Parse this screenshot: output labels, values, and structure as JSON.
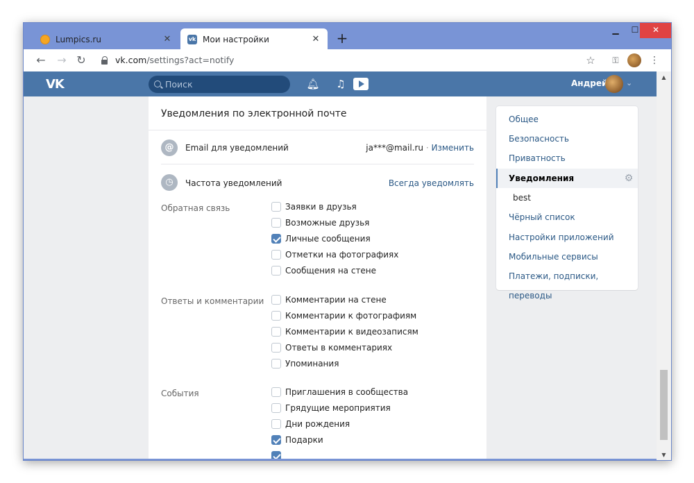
{
  "browser": {
    "tabs": [
      {
        "title": "Lumpics.ru",
        "favicon": "lumpics-icon"
      },
      {
        "title": "Мои настройки",
        "favicon": "vk-icon"
      }
    ],
    "url": {
      "host": "vk.com",
      "path": "/settings?act=notify"
    }
  },
  "vk": {
    "logo": "VK",
    "search_placeholder": "Поиск",
    "user_name": "Андрей"
  },
  "email_section": {
    "title": "Уведомления по электронной почте",
    "email_label": "Email для уведомлений",
    "email_value": "ja***@mail.ru",
    "change_link": "Изменить",
    "frequency_label": "Частота уведомлений",
    "frequency_value": "Всегда уведомлять"
  },
  "groups": [
    {
      "label": "Обратная связь",
      "options": [
        {
          "label": "Заявки в друзья",
          "checked": false
        },
        {
          "label": "Возможные друзья",
          "checked": false
        },
        {
          "label": "Личные сообщения",
          "checked": true
        },
        {
          "label": "Отметки на фотографиях",
          "checked": false
        },
        {
          "label": "Сообщения на стене",
          "checked": false
        }
      ]
    },
    {
      "label": "Ответы и комментарии",
      "options": [
        {
          "label": "Комментарии на стене",
          "checked": false
        },
        {
          "label": "Комментарии к фотографиям",
          "checked": false
        },
        {
          "label": "Комментарии к видеозаписям",
          "checked": false
        },
        {
          "label": "Ответы в комментариях",
          "checked": false
        },
        {
          "label": "Упоминания",
          "checked": false
        }
      ]
    },
    {
      "label": "События",
      "options": [
        {
          "label": "Приглашения в сообщества",
          "checked": false
        },
        {
          "label": "Грядущие мероприятия",
          "checked": false
        },
        {
          "label": "Дни рождения",
          "checked": false
        },
        {
          "label": "Подарки",
          "checked": true
        }
      ]
    }
  ],
  "menu": {
    "items": [
      {
        "label": "Общее"
      },
      {
        "label": "Безопасность"
      },
      {
        "label": "Приватность"
      },
      {
        "label": "Уведомления"
      },
      {
        "label": "best"
      },
      {
        "label": "Чёрный список"
      },
      {
        "label": "Настройки приложений"
      },
      {
        "label": "Мобильные сервисы"
      },
      {
        "label": "Платежи, подписки, переводы"
      }
    ],
    "active_index": 3
  },
  "colors": {
    "vk_header": "#4a76a8",
    "link": "#2a5885",
    "checkbox_checked": "#5181b8",
    "page_bg": "#edeef0",
    "window_frame": "#7994d6"
  }
}
